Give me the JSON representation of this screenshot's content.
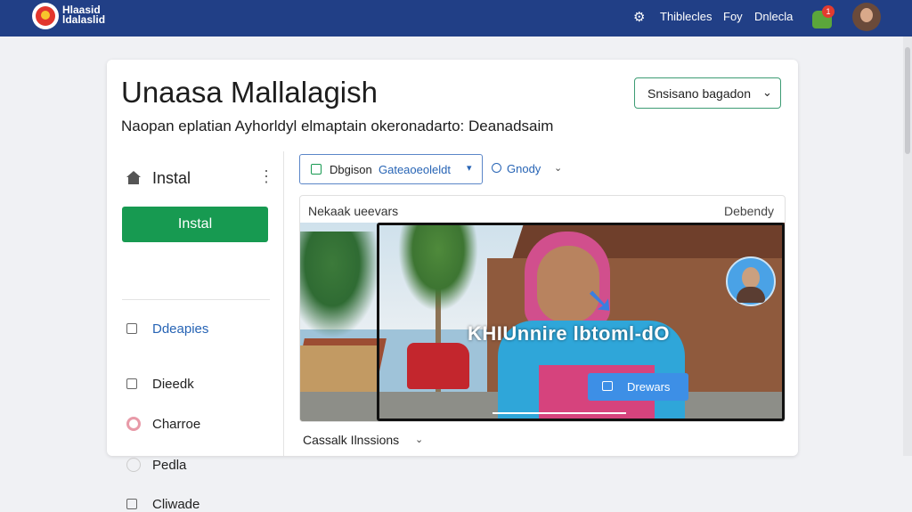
{
  "header": {
    "logo_line1": "Hlaasid",
    "logo_line2": "ldalaslid",
    "nav": [
      "Thiblecles",
      "Foy",
      "Dnlecla"
    ],
    "notification_count": "1"
  },
  "page": {
    "title": "Unaasa Mallalagish",
    "description": "Naopan eplatian Ayhorldyl elmaptain okeronadarto: Deanadsaim",
    "session_select": "Snsisano bagadon"
  },
  "sidebar": {
    "header": "Instal",
    "primary_button": "Instal",
    "items": [
      {
        "label": "Ddeapies",
        "icon": "square-icon",
        "highlight": true
      },
      {
        "label": "Dieedk",
        "icon": "square-icon"
      },
      {
        "label": "Charroe",
        "icon": "circle-icon"
      },
      {
        "label": "Pedla",
        "icon": "circle-icon"
      },
      {
        "label": "Cliwade",
        "icon": "square-icon"
      }
    ]
  },
  "toolbar": {
    "button_text1": "Dbgison",
    "button_text2": "Gateaoeoleldt",
    "link": "Gnody"
  },
  "media": {
    "header_left": "Nekaak ueevars",
    "header_right": "Debendy",
    "overlay_text": "KHIUnnire lbtoml-dO",
    "action_button": "Drewars"
  },
  "footer": {
    "link": "Cassalk Ilnssions"
  },
  "colors": {
    "topbar": "#213f86",
    "primary_green": "#179a51",
    "accent_blue": "#2764b5",
    "video_button": "#3d8fe6"
  }
}
